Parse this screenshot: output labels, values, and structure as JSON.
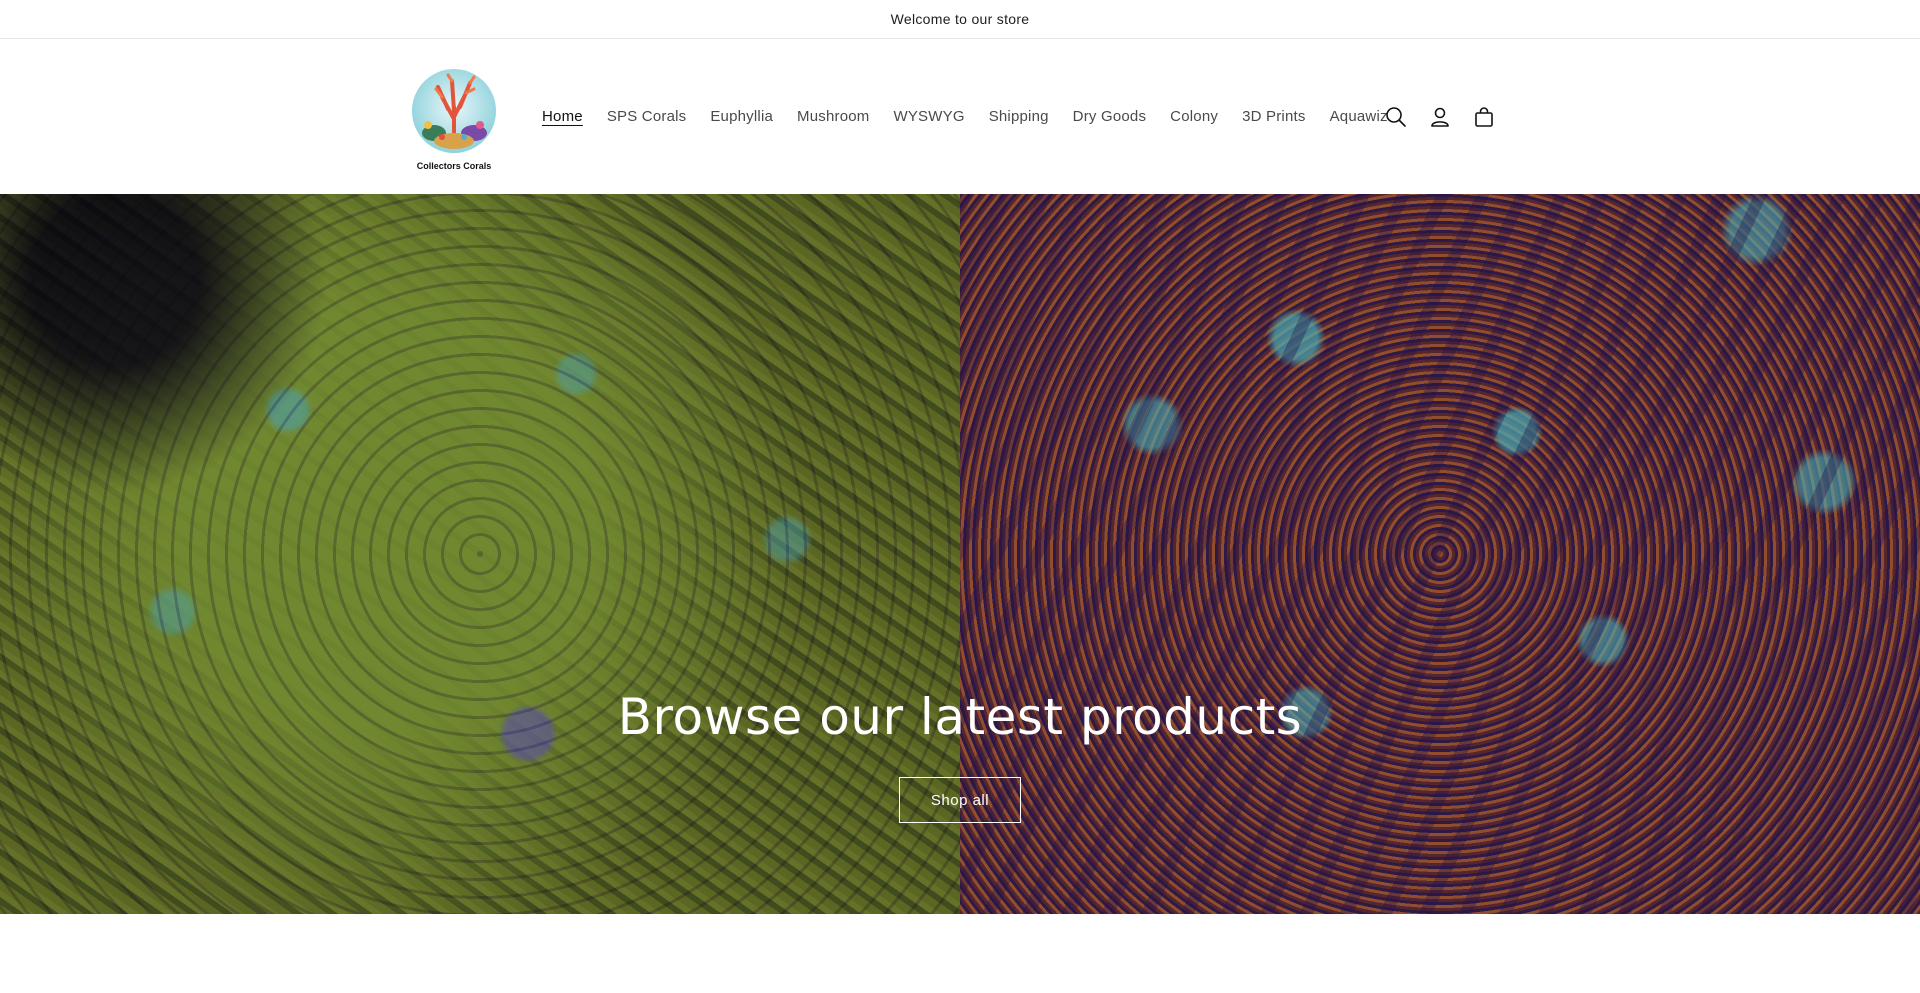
{
  "announcement": {
    "text": "Welcome to our store"
  },
  "logo": {
    "caption": "Collectors Corals"
  },
  "nav": {
    "items": [
      {
        "label": "Home",
        "active": true
      },
      {
        "label": "SPS Corals"
      },
      {
        "label": "Euphyllia"
      },
      {
        "label": "Mushroom"
      },
      {
        "label": "WYSWYG"
      },
      {
        "label": "Shipping"
      },
      {
        "label": "Dry Goods"
      },
      {
        "label": "Colony"
      },
      {
        "label": "3D Prints"
      },
      {
        "label": "Aquawiz"
      }
    ]
  },
  "header_icons": [
    "search-icon",
    "account-icon",
    "cart-icon"
  ],
  "hero": {
    "title": "Browse our latest products",
    "button_label": "Shop all"
  },
  "colors": {
    "text": "#121212",
    "border": "#e6e6e6",
    "hero_text": "#ffffff"
  }
}
